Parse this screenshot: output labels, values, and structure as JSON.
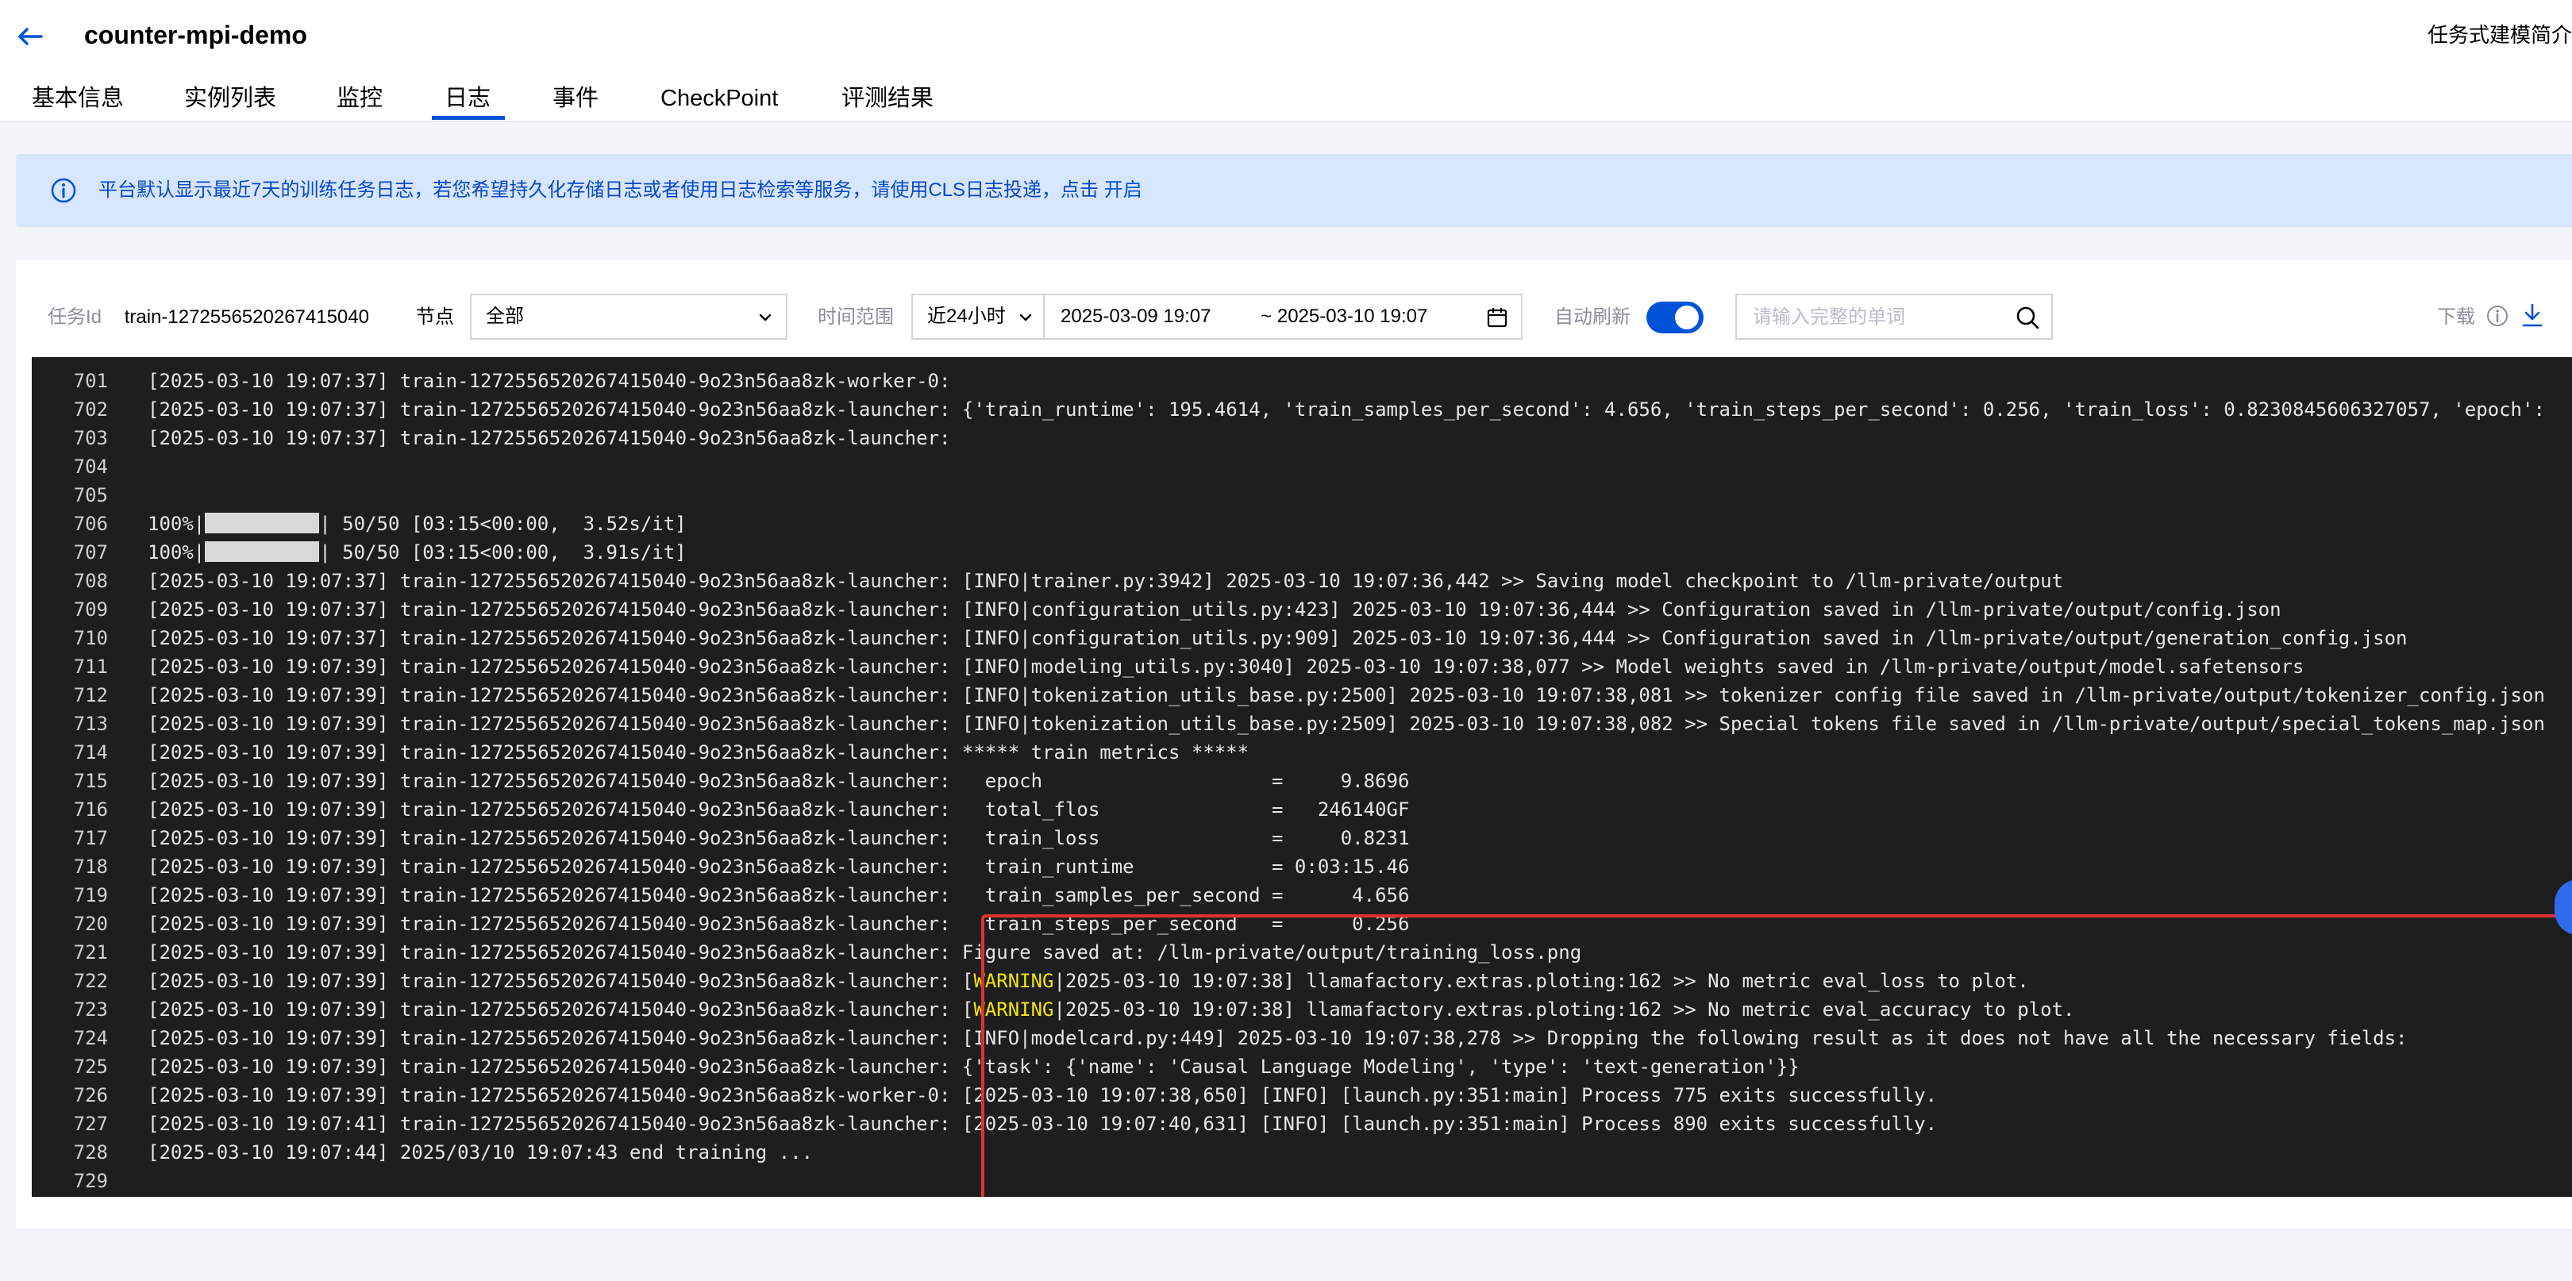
{
  "header": {
    "title": "counter-mpi-demo",
    "intro_link": "任务式建模简介"
  },
  "tabs": [
    {
      "label": "基本信息"
    },
    {
      "label": "实例列表"
    },
    {
      "label": "监控"
    },
    {
      "label": "日志"
    },
    {
      "label": "事件"
    },
    {
      "label": "CheckPoint"
    },
    {
      "label": "评测结果"
    }
  ],
  "active_tab": "日志",
  "notice": {
    "text": "平台默认显示最近7天的训练任务日志，若您希望持久化存储日志或者使用日志检索等服务，请使用CLS日志投递，点击",
    "link": "开启"
  },
  "filters": {
    "task_id_label": "任务Id",
    "task_id_value": "train-1272556520267415040",
    "node_label": "节点",
    "node_value": "全部",
    "time_label": "时间范围",
    "time_preset": "近24小时",
    "date_start": "2025-03-09 19:07",
    "date_end": "~ 2025-03-10 19:07",
    "auto_refresh_label": "自动刷新",
    "auto_refresh_on": true,
    "search_placeholder": "请输入完整的单词",
    "download_label": "下载"
  },
  "log": {
    "lines": [
      {
        "n": "701",
        "t": "[2025-03-10 19:07:37] train-1272556520267415040-9o23n56aa8zk-worker-0:"
      },
      {
        "n": "702",
        "t": "[2025-03-10 19:07:37] train-1272556520267415040-9o23n56aa8zk-launcher: {'train_runtime': 195.4614, 'train_samples_per_second': 4.656, 'train_steps_per_second': 0.256, 'train_loss': 0.8230845606327057, 'epoch':"
      },
      {
        "n": "703",
        "t": "[2025-03-10 19:07:37] train-1272556520267415040-9o23n56aa8zk-launcher:"
      },
      {
        "n": "704",
        "t": ""
      },
      {
        "n": "705",
        "t": ""
      },
      {
        "n": "706",
        "pre": "100%|",
        "post": "| 50/50 [03:15<00:00,  3.52s/it]"
      },
      {
        "n": "707",
        "pre": "100%|",
        "post": "| 50/50 [03:15<00:00,  3.91s/it]"
      },
      {
        "n": "708",
        "t": "[2025-03-10 19:07:37] train-1272556520267415040-9o23n56aa8zk-launcher: [INFO|trainer.py:3942] 2025-03-10 19:07:36,442 >> Saving model checkpoint to /llm-private/output"
      },
      {
        "n": "709",
        "t": "[2025-03-10 19:07:37] train-1272556520267415040-9o23n56aa8zk-launcher: [INFO|configuration_utils.py:423] 2025-03-10 19:07:36,444 >> Configuration saved in /llm-private/output/config.json"
      },
      {
        "n": "710",
        "t": "[2025-03-10 19:07:37] train-1272556520267415040-9o23n56aa8zk-launcher: [INFO|configuration_utils.py:909] 2025-03-10 19:07:36,444 >> Configuration saved in /llm-private/output/generation_config.json"
      },
      {
        "n": "711",
        "t": "[2025-03-10 19:07:39] train-1272556520267415040-9o23n56aa8zk-launcher: [INFO|modeling_utils.py:3040] 2025-03-10 19:07:38,077 >> Model weights saved in /llm-private/output/model.safetensors"
      },
      {
        "n": "712",
        "t": "[2025-03-10 19:07:39] train-1272556520267415040-9o23n56aa8zk-launcher: [INFO|tokenization_utils_base.py:2500] 2025-03-10 19:07:38,081 >> tokenizer config file saved in /llm-private/output/tokenizer_config.json"
      },
      {
        "n": "713",
        "t": "[2025-03-10 19:07:39] train-1272556520267415040-9o23n56aa8zk-launcher: [INFO|tokenization_utils_base.py:2509] 2025-03-10 19:07:38,082 >> Special tokens file saved in /llm-private/output/special_tokens_map.json"
      },
      {
        "n": "714",
        "t": "[2025-03-10 19:07:39] train-1272556520267415040-9o23n56aa8zk-launcher: ***** train metrics *****"
      },
      {
        "n": "715",
        "t": "[2025-03-10 19:07:39] train-1272556520267415040-9o23n56aa8zk-launcher:   epoch                    =     9.8696"
      },
      {
        "n": "716",
        "t": "[2025-03-10 19:07:39] train-1272556520267415040-9o23n56aa8zk-launcher:   total_flos               =   246140GF"
      },
      {
        "n": "717",
        "t": "[2025-03-10 19:07:39] train-1272556520267415040-9o23n56aa8zk-launcher:   train_loss               =     0.8231"
      },
      {
        "n": "718",
        "t": "[2025-03-10 19:07:39] train-1272556520267415040-9o23n56aa8zk-launcher:   train_runtime            = 0:03:15.46"
      },
      {
        "n": "719",
        "t": "[2025-03-10 19:07:39] train-1272556520267415040-9o23n56aa8zk-launcher:   train_samples_per_second =      4.656"
      },
      {
        "n": "720",
        "t": "[2025-03-10 19:07:39] train-1272556520267415040-9o23n56aa8zk-launcher:   train_steps_per_second   =      0.256"
      },
      {
        "n": "721",
        "t": "[2025-03-10 19:07:39] train-1272556520267415040-9o23n56aa8zk-launcher: Figure saved at: /llm-private/output/training_loss.png"
      },
      {
        "n": "722",
        "pre": "[2025-03-10 19:07:39] train-1272556520267415040-9o23n56aa8zk-launcher: [",
        "warn": "WARNING",
        "post": "|2025-03-10 19:07:38] llamafactory.extras.ploting:162 >> No metric eval_loss to plot."
      },
      {
        "n": "723",
        "pre": "[2025-03-10 19:07:39] train-1272556520267415040-9o23n56aa8zk-launcher: [",
        "warn": "WARNING",
        "post": "|2025-03-10 19:07:38] llamafactory.extras.ploting:162 >> No metric eval_accuracy to plot."
      },
      {
        "n": "724",
        "t": "[2025-03-10 19:07:39] train-1272556520267415040-9o23n56aa8zk-launcher: [INFO|modelcard.py:449] 2025-03-10 19:07:38,278 >> Dropping the following result as it does not have all the necessary fields:"
      },
      {
        "n": "725",
        "t": "[2025-03-10 19:07:39] train-1272556520267415040-9o23n56aa8zk-launcher: {'task': {'name': 'Causal Language Modeling', 'type': 'text-generation'}}"
      },
      {
        "n": "726",
        "t": "[2025-03-10 19:07:39] train-1272556520267415040-9o23n56aa8zk-worker-0: [2025-03-10 19:07:38,650] [INFO] [launch.py:351:main] Process 775 exits successfully."
      },
      {
        "n": "727",
        "t": "[2025-03-10 19:07:41] train-1272556520267415040-9o23n56aa8zk-launcher: [2025-03-10 19:07:40,631] [INFO] [launch.py:351:main] Process 890 exits successfully."
      },
      {
        "n": "728",
        "t": "[2025-03-10 19:07:44] 2025/03/10 19:07:43 end training ..."
      },
      {
        "n": "729",
        "t": ""
      }
    ]
  },
  "colors": {
    "accent": "#0052d9",
    "notice_bg": "#d6e6ff",
    "log_bg": "#1e1e1e",
    "warning": "#f2e600",
    "highlight": "#e0312f"
  }
}
